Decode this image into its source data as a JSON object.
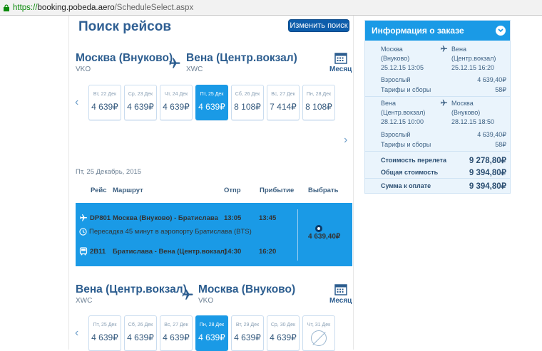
{
  "browser": {
    "url_protocol": "https://",
    "url_host": "booking.pobeda.aero",
    "url_path": "/ScheduleSelect.aspx"
  },
  "header": {
    "title": "Поиск рейсов",
    "change_search_label": "Изменить поиск"
  },
  "outbound": {
    "from": "Москва (Внуково)",
    "from_code": "VKO",
    "to": "Вена (Центр.вокзал)",
    "to_code": "XWC",
    "month_label": "Месяц",
    "dates": [
      {
        "day": "Вт, 22 Дек",
        "price": "4 639₽",
        "selected": false
      },
      {
        "day": "Ср, 23 Дек",
        "price": "4 639₽",
        "selected": false
      },
      {
        "day": "Чт, 24 Дек",
        "price": "4 639₽",
        "selected": false
      },
      {
        "day": "Пт, 25 Дек",
        "price": "4 639₽",
        "selected": true
      },
      {
        "day": "Сб, 26 Дек",
        "price": "8 108₽",
        "selected": false
      },
      {
        "day": "Вс, 27 Дек",
        "price": "7 414₽",
        "selected": false
      },
      {
        "day": "Пн, 28 Дек",
        "price": "8 108₽",
        "selected": false
      }
    ],
    "selected_date_label": "Пт, 25 Декабрь, 2015"
  },
  "table": {
    "col_flight": "Рейс",
    "col_route": "Маршрут",
    "col_dep": "Отпр",
    "col_arr": "Прибытие",
    "col_select": "Выбрать"
  },
  "flight": {
    "leg1_number": "DP801",
    "leg1_route": "Москва (Внуково) - Братислава",
    "leg1_dep": "13:05",
    "leg1_arr": "13:45",
    "transfer_note": "Пересадка 45 минут в аэропорту Братислава (BTS)",
    "leg2_number": "2B11",
    "leg2_route": "Братислава - Вена (Центр.вокзал)",
    "leg2_dep": "14:30",
    "leg2_arr": "16:20",
    "price": "4 639,40₽"
  },
  "return": {
    "from": "Вена (Центр.вокзал)",
    "from_code": "XWC",
    "to": "Москва (Внуково)",
    "to_code": "VKO",
    "month_label": "Месяц",
    "dates": [
      {
        "day": "Пт, 25 Дек",
        "price": "4 639₽",
        "selected": false
      },
      {
        "day": "Сб, 26 Дек",
        "price": "4 639₽",
        "selected": false
      },
      {
        "day": "Вс, 27 Дек",
        "price": "4 639₽",
        "selected": false
      },
      {
        "day": "Пн, 28 Дек",
        "price": "4 639₽",
        "selected": true
      },
      {
        "day": "Вт, 29 Дек",
        "price": "4 639₽",
        "selected": false
      },
      {
        "day": "Ср, 30 Дек",
        "price": "4 639₽",
        "selected": false
      },
      {
        "day": "Чт, 31 Дек",
        "price": "",
        "selected": false,
        "no_flight": true
      }
    ]
  },
  "order_info": {
    "title": "Информация о заказе",
    "out_from": "Москва",
    "out_from2": "(Внуково)",
    "out_dep_time": "25.12.15 13:05",
    "out_to": "Вена",
    "out_to2": "(Центр.вокзал)",
    "out_arr_time": "25.12.15 16:20",
    "out_adult_label": "Взрослый",
    "out_adult_price": "4 639,40₽",
    "out_fees_label": "Тарифы и сборы",
    "out_fees_price": "58₽",
    "ret_from": "Вена",
    "ret_from2": "(Центр.вокзал)",
    "ret_dep_time": "28.12.15 10:00",
    "ret_to": "Москва",
    "ret_to2": "(Внуково)",
    "ret_arr_time": "28.12.15 18:50",
    "ret_adult_label": "Взрослый",
    "ret_adult_price": "4 639,40₽",
    "ret_fees_label": "Тарифы и сборы",
    "ret_fees_price": "58₽",
    "flight_cost_label": "Стоимость перелета",
    "flight_cost": "9 278,80₽",
    "total_label": "Общая стоимость",
    "total": "9 394,80₽",
    "pay_label": "Сумма к оплате",
    "pay": "9 394,80₽"
  },
  "colors": {
    "accent": "#1a9ae6",
    "brand_dark": "#0d5dab",
    "title": "#2f5f93"
  }
}
